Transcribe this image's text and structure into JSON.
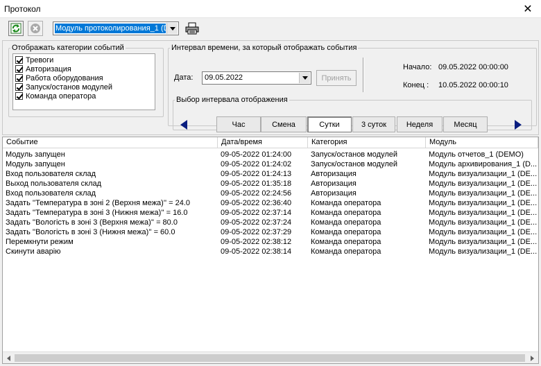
{
  "window": {
    "title": "Протокол"
  },
  "toolbar": {
    "module_select_value": "Модуль протоколирования_1 (D"
  },
  "categories": {
    "legend": "Отображать категории событий",
    "items": [
      {
        "label": "Тревоги",
        "checked": true
      },
      {
        "label": "Авторизация",
        "checked": true
      },
      {
        "label": "Работа оборудования",
        "checked": true
      },
      {
        "label": "Запуск/останов модулей",
        "checked": true
      },
      {
        "label": "Команда оператора",
        "checked": true
      }
    ]
  },
  "interval": {
    "legend": "Интервал времени, за который отображать события",
    "date_label": "Дата:",
    "date_value": "09.05.2022",
    "apply_label": "Принять",
    "start_label": "Начало:",
    "start_value": "09.05.2022  00:00:00",
    "end_label": "Конец :",
    "end_value": "10.05.2022  00:00:10",
    "range_legend": "Выбор интервала отображения",
    "buttons": [
      {
        "label": "Час",
        "active": false
      },
      {
        "label": "Смена",
        "active": false
      },
      {
        "label": "Сутки",
        "active": true
      },
      {
        "label": "3 суток",
        "active": false
      },
      {
        "label": "Неделя",
        "active": false
      },
      {
        "label": "Месяц",
        "active": false
      }
    ]
  },
  "table": {
    "columns": [
      "Событие",
      "Дата/время",
      "Категория",
      "Модуль"
    ],
    "rows": [
      [
        "Модуль запущен",
        "09-05-2022 01:24:00",
        "Запуск/останов модулей",
        "Модуль отчетов_1 (DEMO)"
      ],
      [
        "Модуль запущен",
        "09-05-2022 01:24:02",
        "Запуск/останов модулей",
        "Модуль архивирования_1 (D..."
      ],
      [
        "Вход пользователя склад",
        "09-05-2022 01:24:13",
        "Авторизация",
        "Модуль визуализации_1 (DE..."
      ],
      [
        "Выход пользователя склад",
        "09-05-2022 01:35:18",
        "Авторизация",
        "Модуль визуализации_1 (DE..."
      ],
      [
        "Вход пользователя склад",
        "09-05-2022 02:24:56",
        "Авторизация",
        "Модуль визуализации_1 (DE..."
      ],
      [
        "Задать ''Температура в зоні 2 (Верхня межа)'' = 24.0",
        "09-05-2022 02:36:40",
        "Команда оператора",
        "Модуль визуализации_1 (DE..."
      ],
      [
        "Задать ''Температура в зоні 3 (Нижня межа)'' = 16.0",
        "09-05-2022 02:37:14",
        "Команда оператора",
        "Модуль визуализации_1 (DE..."
      ],
      [
        "Задать ''Вологість в зоні 3 (Верхня межа)'' = 80.0",
        "09-05-2022 02:37:24",
        "Команда оператора",
        "Модуль визуализации_1 (DE..."
      ],
      [
        "Задать ''Вологість в зоні 3 (Нижня межа)'' = 60.0",
        "09-05-2022 02:37:29",
        "Команда оператора",
        "Модуль визуализации_1 (DE..."
      ],
      [
        "Перемкнути режим",
        "09-05-2022 02:38:12",
        "Команда оператора",
        "Модуль визуализации_1 (DE..."
      ],
      [
        "Скинути аварію",
        "09-05-2022 02:38:14",
        "Команда оператора",
        "Модуль визуализации_1 (DE..."
      ]
    ]
  }
}
